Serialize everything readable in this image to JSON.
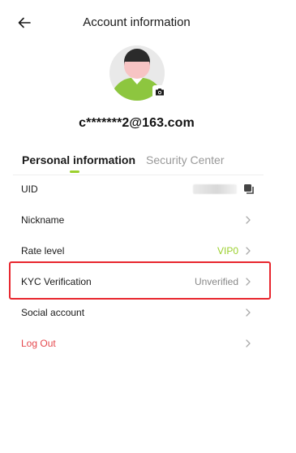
{
  "header": {
    "title": "Account information",
    "back_icon": "arrow-left-icon"
  },
  "profile": {
    "email": "c*******2@163.com",
    "camera_icon": "camera-icon"
  },
  "tabs": [
    {
      "label": "Personal information",
      "active": true
    },
    {
      "label": "Security Center",
      "active": false
    }
  ],
  "rows": {
    "uid": {
      "label": "UID"
    },
    "nickname": {
      "label": "Nickname"
    },
    "rate_level": {
      "label": "Rate level",
      "value": "VIP0"
    },
    "kyc": {
      "label": "KYC Verification",
      "value": "Unverified"
    },
    "social": {
      "label": "Social account"
    },
    "logout": {
      "label": "Log Out"
    }
  },
  "colors": {
    "accent": "#9bd02d",
    "danger": "#e5484d",
    "highlight_box": "#e8262e"
  }
}
